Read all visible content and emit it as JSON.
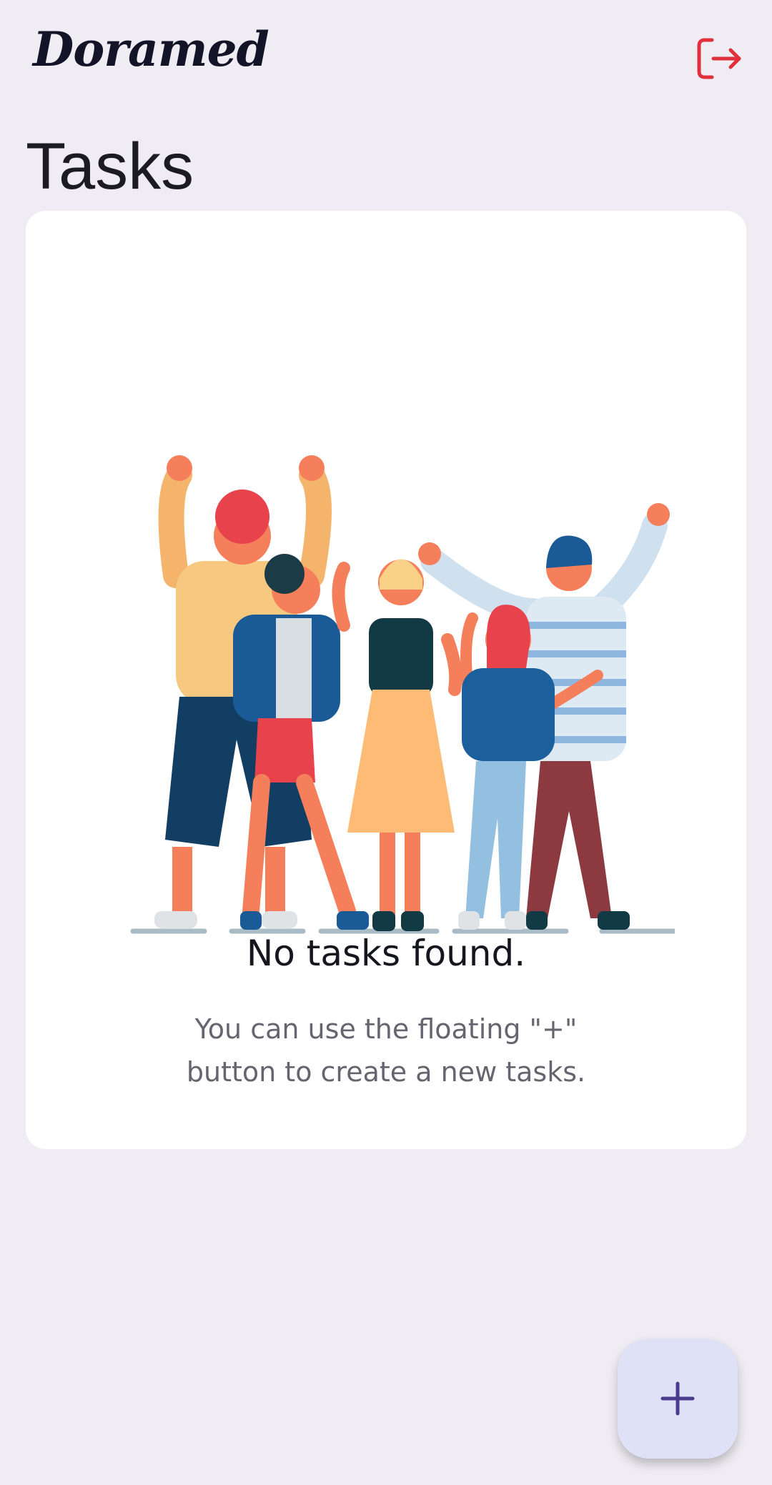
{
  "header": {
    "logo_text": "Doramed",
    "logout_icon": "logout-icon"
  },
  "page": {
    "title": "Tasks"
  },
  "empty_state": {
    "illustration": "group-of-people-waving-illustration",
    "title": "No tasks found.",
    "message": "You can use the floating \"+\" button to create a new tasks."
  },
  "fab": {
    "icon": "plus-icon"
  },
  "colors": {
    "background": "#efedf3",
    "card": "#ffffff",
    "logout_accent": "#e0303c",
    "fab_background": "#dfe1f6",
    "fab_icon": "#4a3b8f"
  }
}
